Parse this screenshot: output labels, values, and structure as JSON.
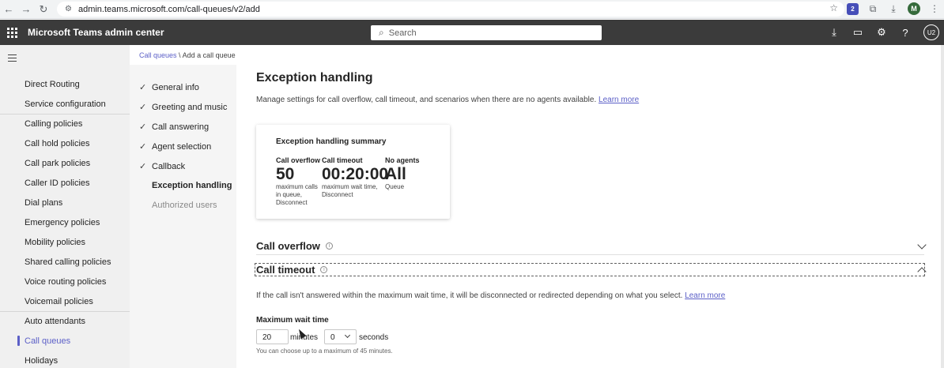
{
  "browser": {
    "url": "admin.teams.microsoft.com/call-queues/v2/add",
    "teams_badge": "2",
    "profile_letter": "M"
  },
  "app": {
    "title": "Microsoft Teams admin center",
    "search_placeholder": "Search",
    "avatar_initials": "U2"
  },
  "nav": {
    "items": [
      "Direct Routing",
      "Service configuration",
      "Calling policies",
      "Call hold policies",
      "Call park policies",
      "Caller ID policies",
      "Dial plans",
      "Emergency policies",
      "Mobility policies",
      "Shared calling policies",
      "Voice routing policies",
      "Voicemail policies",
      "Auto attendants",
      "Call queues",
      "Holidays"
    ],
    "active": "Call queues"
  },
  "breadcrumb": {
    "parent": "Call queues",
    "separator": "\\",
    "current": "Add a call queue"
  },
  "steps": [
    {
      "label": "General info",
      "state": "done"
    },
    {
      "label": "Greeting and music",
      "state": "done"
    },
    {
      "label": "Call answering",
      "state": "done"
    },
    {
      "label": "Agent selection",
      "state": "done"
    },
    {
      "label": "Callback",
      "state": "done"
    },
    {
      "label": "Exception handling",
      "state": "current"
    },
    {
      "label": "Authorized users",
      "state": "pending"
    }
  ],
  "main": {
    "title": "Exception handling",
    "description": "Manage settings for call overflow, call timeout, and scenarios when there are no agents available.",
    "learn_more": "Learn more",
    "summary": {
      "title": "Exception handling summary",
      "metrics": [
        {
          "label": "Call overflow",
          "value": "50",
          "note1": "maximum calls",
          "note2": "in queue,",
          "note3": "Disconnect"
        },
        {
          "label": "Call timeout",
          "value": "00:20:00",
          "note1": "maximum wait time,",
          "note2": "Disconnect",
          "note3": ""
        },
        {
          "label": "No agents",
          "value": "All",
          "note1": "Queue",
          "note2": "",
          "note3": ""
        }
      ]
    },
    "overflow": {
      "title": "Call overflow"
    },
    "timeout": {
      "title": "Call timeout",
      "description": "If the call isn't answered within the maximum wait time, it will be disconnected or redirected depending on what you select.",
      "learn_more": "Learn more",
      "wait_label": "Maximum wait time",
      "minutes_value": "20",
      "minutes_unit": "minutes",
      "seconds_value": "0",
      "seconds_unit": "seconds",
      "hint": "You can choose up to a maximum of 45 minutes."
    }
  }
}
